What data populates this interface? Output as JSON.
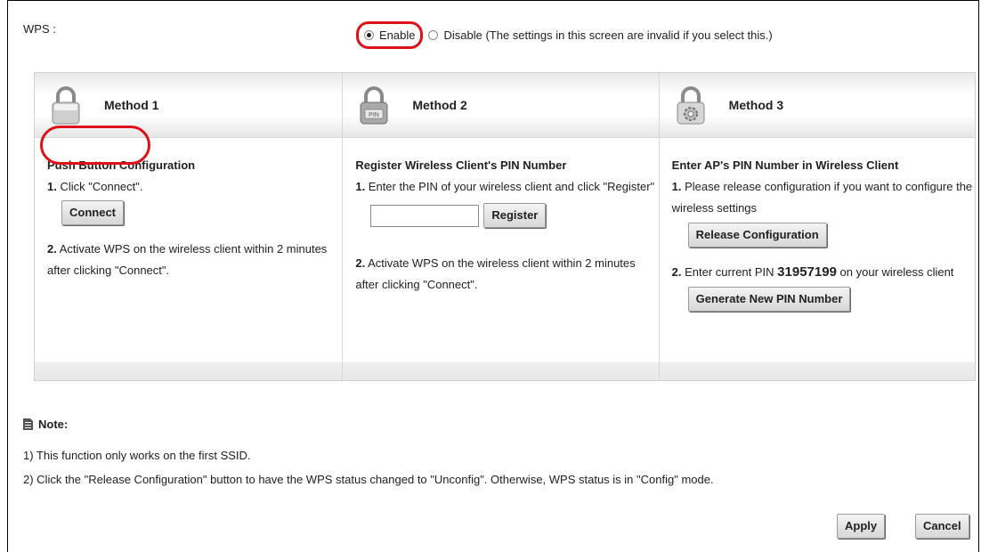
{
  "wps": {
    "label": "WPS :",
    "enable_label": "Enable",
    "disable_label": "Disable (The settings in this screen are invalid if you select this.)",
    "selected": "Enable"
  },
  "methods": [
    {
      "title": "Method 1",
      "icon": "lock-icon",
      "heading": "Push Button Configuration",
      "step1_num": "1.",
      "step1_text": " Click \"Connect\".",
      "button": "Connect",
      "step2_num": "2.",
      "step2_text": " Activate WPS on the wireless client within 2 minutes after clicking \"Connect\"."
    },
    {
      "title": "Method 2",
      "icon": "pin-lock-icon",
      "icon_text": "PIN",
      "heading": "Register Wireless Client's PIN Number",
      "step1_num": "1.",
      "step1_text": " Enter the PIN of your wireless client and click \"Register\"",
      "pin_input_value": "",
      "button": "Register",
      "step2_num": "2.",
      "step2_text": " Activate WPS on the wireless client within 2 minutes after clicking \"Connect\"."
    },
    {
      "title": "Method 3",
      "icon": "gear-lock-icon",
      "heading": "Enter AP's PIN Number in Wireless Client",
      "step1_num": "1.",
      "step1_text": " Please release configuration if you want to configure the wireless settings",
      "button": "Release Configuration",
      "step2_num": "2.",
      "step2_pre": " Enter current PIN ",
      "pin": "31957199",
      "step2_post": " on your wireless client",
      "button2": "Generate New PIN Number"
    }
  ],
  "note": {
    "title": "Note:",
    "lines": [
      "1) This function only works on the first SSID.",
      "2) Click the \"Release Configuration\" button to have the WPS status changed to \"Unconfig\". Otherwise, WPS status is in \"Config\" mode."
    ]
  },
  "footer": {
    "apply": "Apply",
    "cancel": "Cancel"
  },
  "colors": {
    "highlight": "#e0101a"
  }
}
